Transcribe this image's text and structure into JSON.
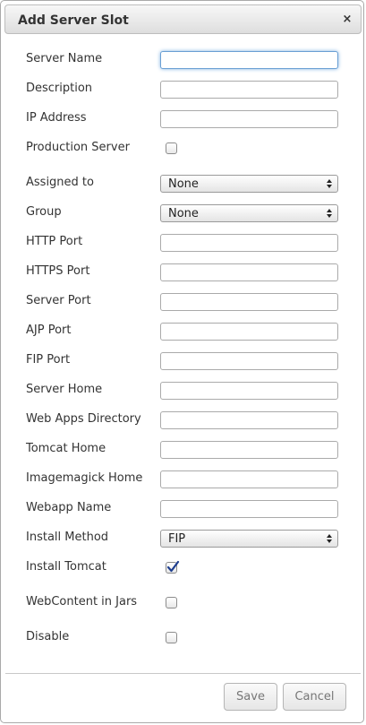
{
  "dialog": {
    "title": "Add Server Slot",
    "close_glyph": "×"
  },
  "fields": {
    "server_name": {
      "label": "Server Name",
      "value": ""
    },
    "description": {
      "label": "Description",
      "value": ""
    },
    "ip_address": {
      "label": "IP Address",
      "value": ""
    },
    "production_server": {
      "label": "Production Server",
      "checked": false
    },
    "assigned_to": {
      "label": "Assigned to",
      "selected": "None"
    },
    "group": {
      "label": "Group",
      "selected": "None"
    },
    "http_port": {
      "label": "HTTP Port",
      "value": ""
    },
    "https_port": {
      "label": "HTTPS Port",
      "value": ""
    },
    "server_port": {
      "label": "Server Port",
      "value": ""
    },
    "ajp_port": {
      "label": "AJP Port",
      "value": ""
    },
    "fip_port": {
      "label": "FIP Port",
      "value": ""
    },
    "server_home": {
      "label": "Server Home",
      "value": ""
    },
    "web_apps_directory": {
      "label": "Web Apps Directory",
      "value": ""
    },
    "tomcat_home": {
      "label": "Tomcat Home",
      "value": ""
    },
    "imagemagick_home": {
      "label": "Imagemagick Home",
      "value": ""
    },
    "webapp_name": {
      "label": "Webapp Name",
      "value": ""
    },
    "install_method": {
      "label": "Install Method",
      "selected": "FIP"
    },
    "install_tomcat": {
      "label": "Install Tomcat",
      "checked": true
    },
    "webcontent_in_jars": {
      "label": "WebContent in Jars",
      "checked": false
    },
    "disable": {
      "label": "Disable",
      "checked": false
    }
  },
  "footer": {
    "save_label": "Save",
    "cancel_label": "Cancel"
  },
  "colors": {
    "focus_ring": "#6a9fd4",
    "check_mark": "#1f3f8f"
  },
  "icons": {
    "close": "close-icon",
    "select_arrows": "select-arrows-icon",
    "check": "checkmark-icon"
  }
}
